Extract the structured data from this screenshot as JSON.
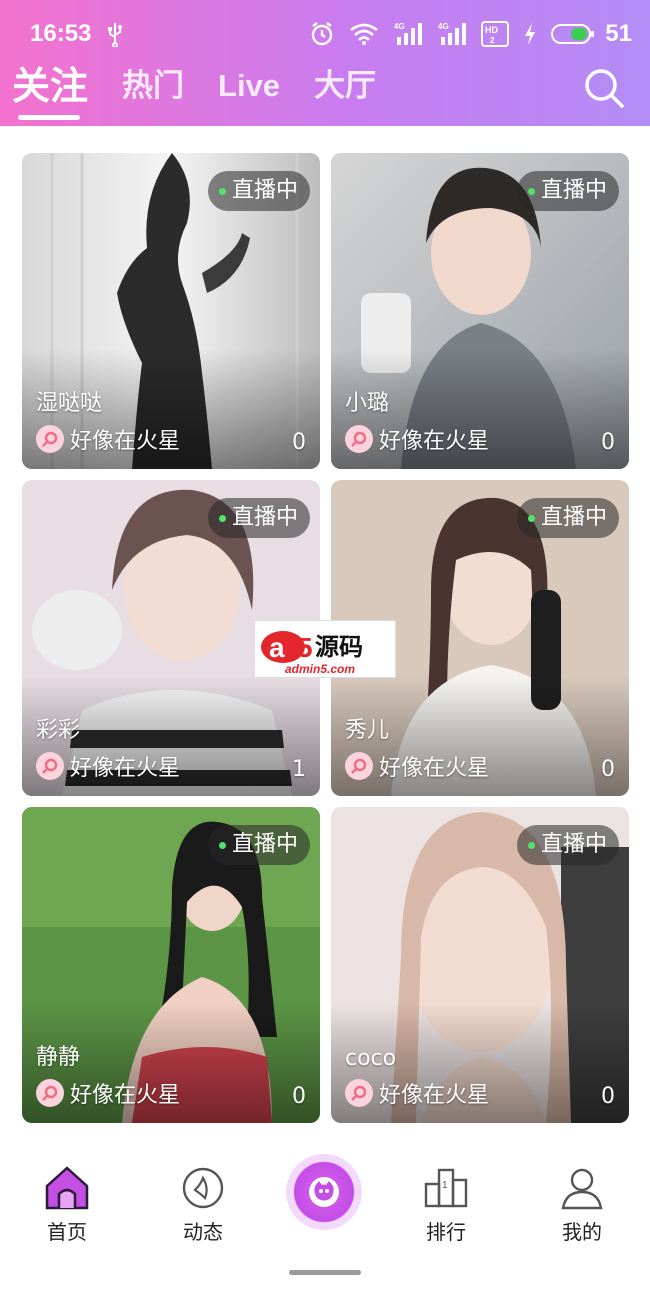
{
  "status_bar": {
    "time": "16:53",
    "battery_level": "51",
    "icons": [
      "usb-icon",
      "alarm-icon",
      "wifi-icon",
      "signal-4g-icon",
      "signal-4g-icon",
      "hd-icon",
      "charging-icon",
      "battery-icon"
    ]
  },
  "tabs": [
    {
      "label": "关注",
      "active": true
    },
    {
      "label": "热门",
      "active": false
    },
    {
      "label": "Live",
      "active": false
    },
    {
      "label": "大厅",
      "active": false
    }
  ],
  "live_badge": "直播中",
  "cards": [
    {
      "name": "湿哒哒",
      "location": "好像在火星",
      "count": "0",
      "photo_colors": [
        "#e9e9e9",
        "#8f8f8f",
        "#2a2a2a"
      ]
    },
    {
      "name": "小璐",
      "location": "好像在火星",
      "count": "0",
      "photo_colors": [
        "#c9c9c9",
        "#8a8f96",
        "#e8d5cc"
      ]
    },
    {
      "name": "彩彩",
      "location": "好像在火星",
      "count": "1",
      "photo_colors": [
        "#e8dde4",
        "#6b5c5a",
        "#f0e7ec"
      ]
    },
    {
      "name": "秀儿",
      "location": "好像在火星",
      "count": "0",
      "photo_colors": [
        "#d8c6b8",
        "#3b2e2c",
        "#f2ede8"
      ]
    },
    {
      "name": "静静",
      "location": "好像在火星",
      "count": "0",
      "photo_colors": [
        "#4d8a3c",
        "#7fb35a",
        "#c9444a"
      ]
    },
    {
      "name": "coco",
      "location": "好像在火星",
      "count": "0",
      "photo_colors": [
        "#ece3e3",
        "#d9b9ad",
        "#4a4a4a"
      ]
    }
  ],
  "watermark": {
    "brand": "a5源码",
    "url": "admin5.com"
  },
  "bottom_nav": [
    {
      "label": "首页",
      "icon": "home-icon",
      "active": true
    },
    {
      "label": "动态",
      "icon": "moments-icon",
      "active": false
    },
    {
      "label": "",
      "icon": "live-start-icon",
      "active": false
    },
    {
      "label": "排行",
      "icon": "ranking-icon",
      "active": false
    },
    {
      "label": "我的",
      "icon": "profile-icon",
      "active": false
    }
  ],
  "colors": {
    "header_gradient_start": "#f472cf",
    "header_gradient_end": "#b48cf5",
    "accent": "#c44ee6",
    "live_dot": "#52e36c"
  }
}
